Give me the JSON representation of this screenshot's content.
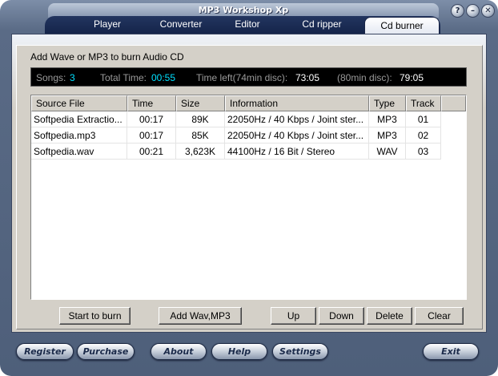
{
  "window": {
    "title": "MP3 Workshop Xp"
  },
  "window_controls": {
    "help": "?",
    "minimize": "–",
    "close": "✕"
  },
  "tabs": [
    {
      "label": "Player"
    },
    {
      "label": "Converter"
    },
    {
      "label": "Editor"
    },
    {
      "label": "Cd ripper"
    },
    {
      "label": "Cd burner",
      "active": true
    }
  ],
  "main": {
    "heading": "Add Wave or MP3 to burn Audio CD",
    "info": {
      "songs_label": "Songs:",
      "songs_value": "3",
      "total_time_label": "Total Time:",
      "total_time_value": "00:55",
      "time_left_74_label": "Time left(74min disc):",
      "time_left_74_value": "73:05",
      "time_left_80_label": "(80min disc):",
      "time_left_80_value": "79:05"
    },
    "table": {
      "columns": [
        "Source File",
        "Time",
        "Size",
        "Information",
        "Type",
        "Track"
      ],
      "rows": [
        [
          "Softpedia Extractio...",
          "00:17",
          "89K",
          "22050Hz / 40 Kbps / Joint ster...",
          "MP3",
          "01"
        ],
        [
          "Softpedia.mp3",
          "00:17",
          "85K",
          "22050Hz / 40 Kbps / Joint ster...",
          "MP3",
          "02"
        ],
        [
          "Softpedia.wav",
          "00:21",
          "3,623K",
          "44100Hz / 16 Bit / Stereo",
          "WAV",
          "03"
        ]
      ]
    },
    "buttons": {
      "start_burn": "Start to burn",
      "add": "Add Wav,MP3",
      "up": "Up",
      "down": "Down",
      "delete": "Delete",
      "clear": "Clear"
    }
  },
  "footer": {
    "register": "Register",
    "purchase": "Purchase",
    "about": "About",
    "help": "Help",
    "settings": "Settings",
    "exit": "Exit"
  },
  "colors": {
    "frame": "#4e5f7a",
    "tabstrip": "#14244a",
    "infobar_bg": "#000000",
    "infobar_value": "#00e0ff",
    "panel": "#d4d0c8"
  }
}
